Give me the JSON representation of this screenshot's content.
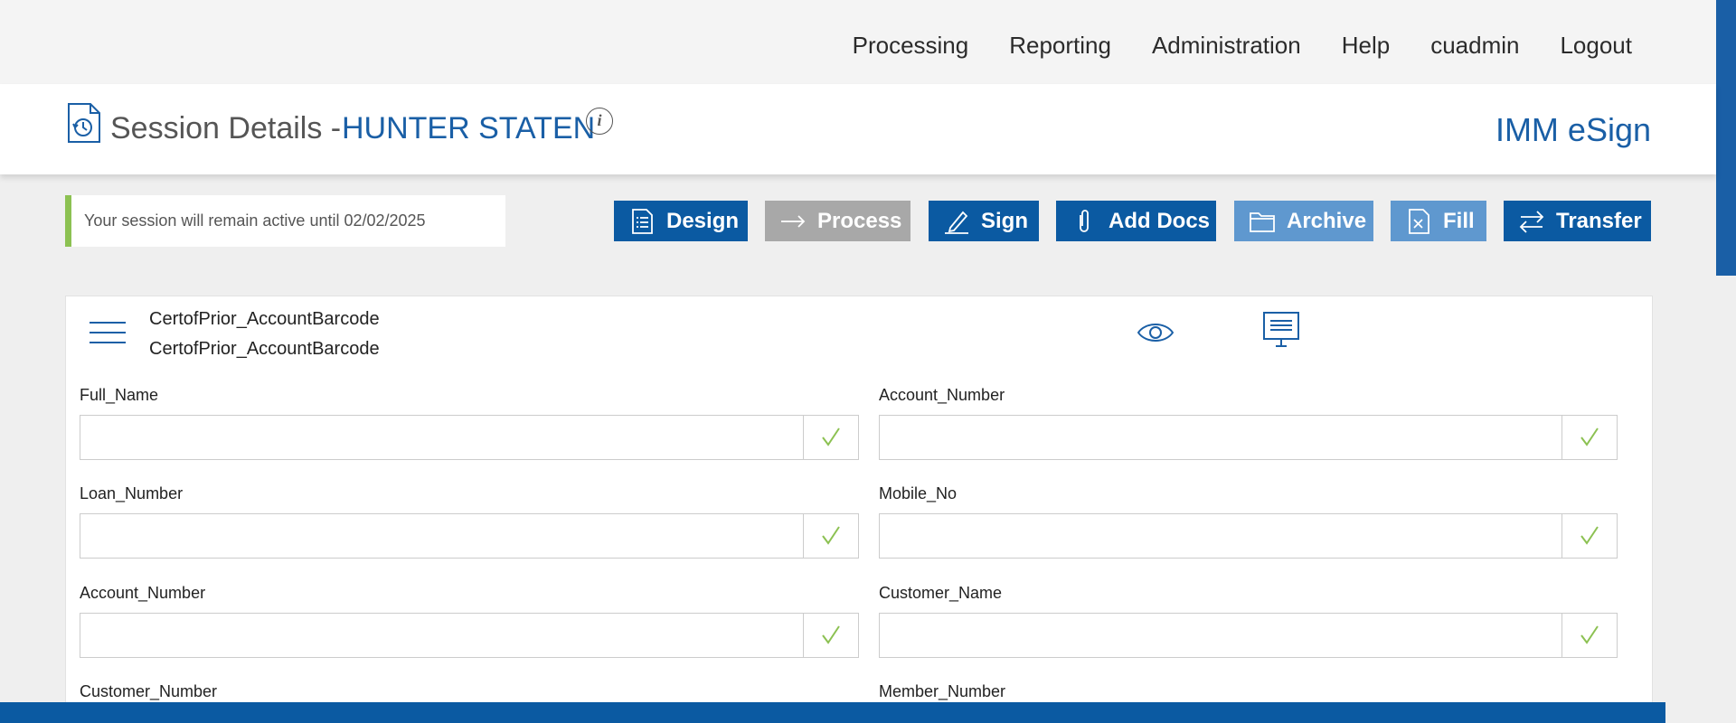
{
  "nav": {
    "items": [
      "Processing",
      "Reporting",
      "Administration",
      "Help",
      "cuadmin",
      "Logout"
    ]
  },
  "header": {
    "title": "Session Details -",
    "name": "HUNTER STATEN",
    "info_glyph": "i",
    "brand": "IMM eSign"
  },
  "session": {
    "notice": "Your session will remain active until 02/02/2025"
  },
  "toolbar": {
    "design": "Design",
    "process": "Process",
    "sign": "Sign",
    "add_docs": "Add Docs",
    "archive": "Archive",
    "fill": "Fill",
    "transfer": "Transfer"
  },
  "document": {
    "title_line1": "CertofPrior_AccountBarcode",
    "title_line2": "CertofPrior_AccountBarcode",
    "fields": [
      {
        "label": "Full_Name",
        "value": ""
      },
      {
        "label": "Account_Number",
        "value": ""
      },
      {
        "label": "Loan_Number",
        "value": ""
      },
      {
        "label": "Mobile_No",
        "value": ""
      },
      {
        "label": "Account_Number",
        "value": ""
      },
      {
        "label": "Customer_Name",
        "value": ""
      },
      {
        "label": "Customer_Number",
        "value": ""
      },
      {
        "label": "Member_Number",
        "value": ""
      }
    ]
  },
  "colors": {
    "primary": "#0b5aa2",
    "primary_light": "#5f98cf",
    "disabled": "#a8a8a8",
    "accent_green": "#8cc152",
    "brand_text": "#1a5fa6"
  },
  "icons": {
    "title": "session-history-doc-icon",
    "design": "checklist-doc-icon",
    "process": "arrow-right-icon",
    "sign": "pen-sign-icon",
    "add_docs": "paperclip-icon",
    "archive": "folder-icon",
    "fill": "doc-fill-icon",
    "transfer": "swap-arrows-icon",
    "menu": "hamburger-icon",
    "preview": "eye-icon",
    "present": "monitor-icon",
    "field_check": "checkmark-icon"
  }
}
